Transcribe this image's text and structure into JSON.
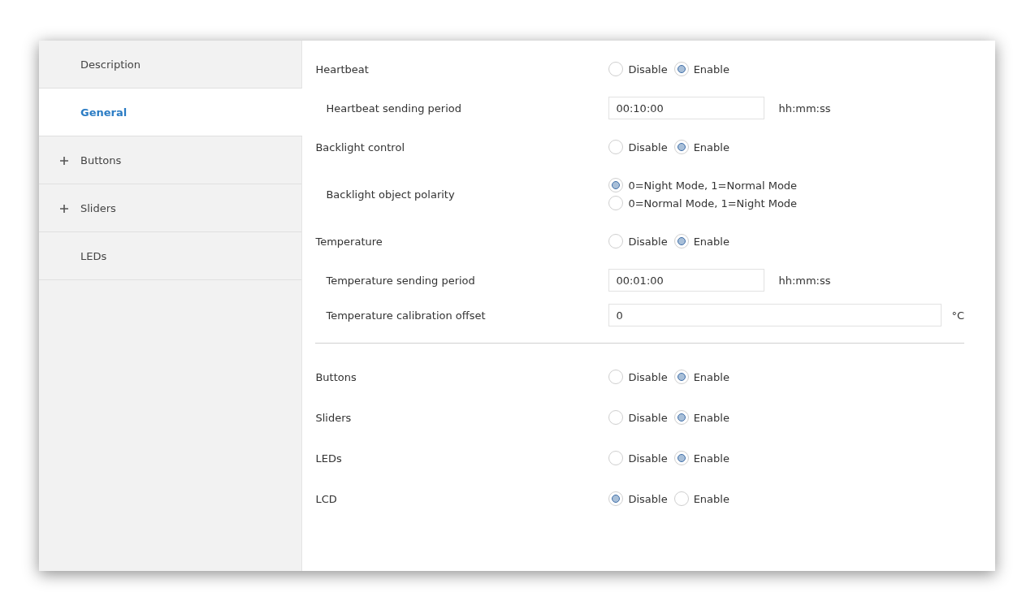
{
  "sidebar": {
    "items": [
      {
        "label": "Description",
        "selected": false,
        "expandable": false
      },
      {
        "label": "General",
        "selected": true,
        "expandable": false
      },
      {
        "label": "Buttons",
        "selected": false,
        "expandable": true
      },
      {
        "label": "Sliders",
        "selected": false,
        "expandable": true
      },
      {
        "label": "LEDs",
        "selected": false,
        "expandable": false
      }
    ]
  },
  "sections": [
    {
      "parameters": [
        {
          "kind": "radio",
          "label": "Heartbeat",
          "options": [
            {
              "label": "Disable",
              "selected": false
            },
            {
              "label": "Enable",
              "selected": true
            }
          ],
          "children": [
            {
              "kind": "short-field",
              "label": "Heartbeat sending period",
              "value": "00:10:00",
              "unit": "hh:mm:ss"
            }
          ]
        },
        {
          "kind": "radio",
          "label": "Backlight control",
          "options": [
            {
              "label": "Disable",
              "selected": false
            },
            {
              "label": "Enable",
              "selected": true
            }
          ],
          "children": [
            {
              "kind": "radio-stack",
              "label": "Backlight object polarity",
              "options": [
                {
                  "label": "0=Night Mode, 1=Normal Mode",
                  "selected": true
                },
                {
                  "label": "0=Normal Mode, 1=Night Mode",
                  "selected": false
                }
              ]
            }
          ]
        },
        {
          "kind": "radio",
          "label": "Temperature",
          "options": [
            {
              "label": "Disable",
              "selected": false
            },
            {
              "label": "Enable",
              "selected": true
            }
          ],
          "children": [
            {
              "kind": "short-field",
              "label": "Temperature sending period",
              "value": "00:01:00",
              "unit": "hh:mm:ss"
            },
            {
              "kind": "long-field",
              "label": "Temperature calibration offset",
              "value": "0",
              "unit": "°C"
            }
          ]
        }
      ]
    },
    {
      "parameters": [
        {
          "kind": "radio",
          "label": "Buttons",
          "options": [
            {
              "label": "Disable",
              "selected": false
            },
            {
              "label": "Enable",
              "selected": true
            }
          ]
        },
        {
          "kind": "radio",
          "label": "Sliders",
          "options": [
            {
              "label": "Disable",
              "selected": false
            },
            {
              "label": "Enable",
              "selected": true
            }
          ]
        },
        {
          "kind": "radio",
          "label": "LEDs",
          "options": [
            {
              "label": "Disable",
              "selected": false
            },
            {
              "label": "Enable",
              "selected": true
            }
          ]
        },
        {
          "kind": "radio",
          "label": "LCD",
          "options": [
            {
              "label": "Disable",
              "selected": true
            },
            {
              "label": "Enable",
              "selected": false
            }
          ]
        }
      ]
    }
  ]
}
